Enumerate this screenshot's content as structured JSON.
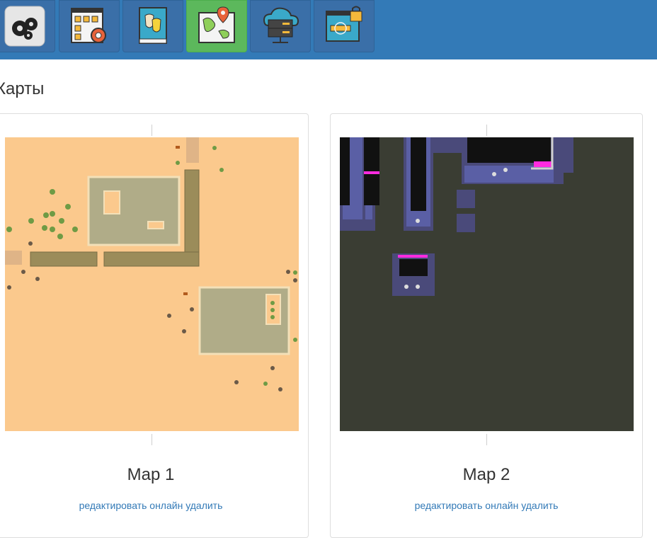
{
  "toolbar": {
    "buttons": [
      {
        "icon": "gears-icon",
        "active": false
      },
      {
        "icon": "layout-settings-icon",
        "active": false
      },
      {
        "icon": "theatre-book-icon",
        "active": false
      },
      {
        "icon": "map-pin-icon",
        "active": true
      },
      {
        "icon": "cloud-server-icon",
        "active": false
      },
      {
        "icon": "secure-login-icon",
        "active": false
      }
    ],
    "colors": {
      "bar": "#337ab7",
      "active": "#5cb85c"
    }
  },
  "page": {
    "title": "Карты"
  },
  "maps": [
    {
      "name": "Map 1",
      "links": {
        "edit": "редактировать",
        "online": "онлайн",
        "delete": "удалить"
      }
    },
    {
      "name": "Map 2",
      "links": {
        "edit": "редактировать",
        "online": "онлайн",
        "delete": "удалить"
      }
    }
  ]
}
